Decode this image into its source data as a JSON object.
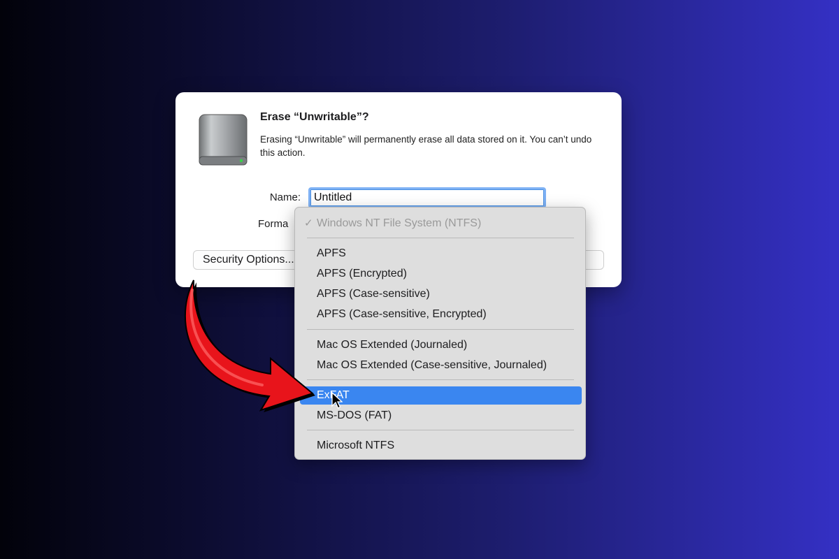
{
  "dialog": {
    "title": "Erase “Unwritable”?",
    "message": "Erasing “Unwritable” will permanently erase all data stored on it. You can’t undo this action.",
    "name_label": "Name:",
    "name_value": "Untitled",
    "format_label": "Forma",
    "security_button": "Security Options...",
    "disk_icon": "external-drive-icon"
  },
  "format_menu": {
    "current": "Windows NT File System (NTFS)",
    "groups": [
      [
        "APFS",
        "APFS (Encrypted)",
        "APFS (Case-sensitive)",
        "APFS (Case-sensitive, Encrypted)"
      ],
      [
        "Mac OS Extended (Journaled)",
        "Mac OS Extended (Case-sensitive, Journaled)"
      ],
      [
        "ExFAT",
        "MS-DOS (FAT)"
      ],
      [
        "Microsoft NTFS"
      ]
    ],
    "highlighted": "ExFAT",
    "highlight_color": "#3a86f0"
  },
  "annotation": {
    "arrow_color": "#e8141b",
    "arrow_icon": "curved-arrow-icon",
    "cursor_icon": "mouse-pointer-icon"
  }
}
